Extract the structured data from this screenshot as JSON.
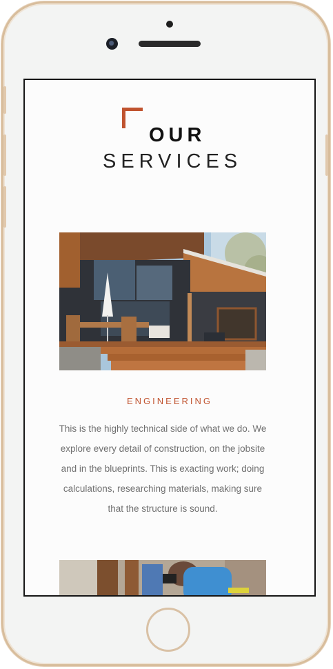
{
  "page": {
    "title_line1": "OUR",
    "title_line2": "SERVICES"
  },
  "services": [
    {
      "heading": "ENGINEERING",
      "description": "This is the highly technical side of what we do. We explore every detail of construction, on the jobsite and in the blueprints. This is exacting work; doing calculations, researching materials, making sure that the structure is sound.",
      "image": "deck-house-photo"
    },
    {
      "image": "workers-photo"
    }
  ],
  "colors": {
    "accent": "#c0532f",
    "frame": "#d8bd9c",
    "text": "#707070"
  }
}
